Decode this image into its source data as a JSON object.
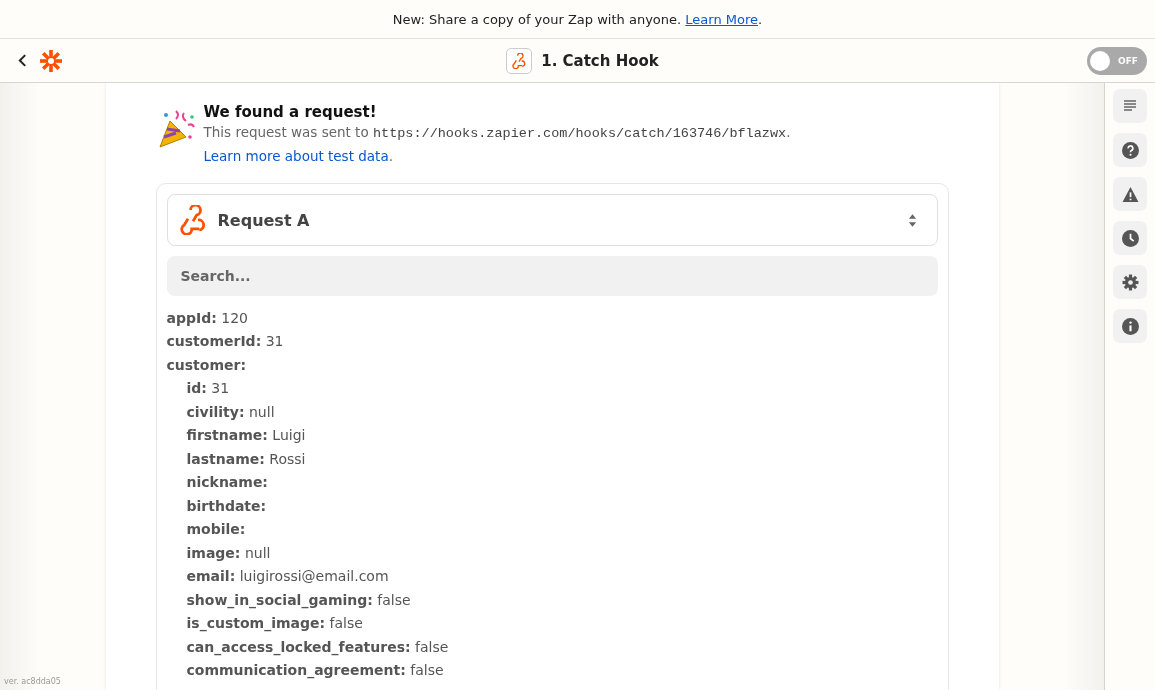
{
  "banner": {
    "text": "New: Share a copy of your Zap with anyone.",
    "link": "Learn More",
    "suffix": "."
  },
  "header": {
    "title": "1. Catch Hook",
    "toggle": {
      "label": "OFF",
      "on": false
    }
  },
  "found": {
    "title": "We found a request!",
    "prefix": "This request was sent to",
    "url": "https://hooks.zapier.com/hooks/catch/163746/bflazwx",
    "after": ".",
    "link": "Learn more about test data",
    "end": "."
  },
  "request_select": {
    "value": "Request A"
  },
  "search": {
    "placeholder": "Search..."
  },
  "fields": [
    {
      "key": "appId:",
      "value": "120"
    },
    {
      "key": "customerId:",
      "value": "31"
    },
    {
      "key": "customer:",
      "children": [
        {
          "key": "id:",
          "value": "31"
        },
        {
          "key": "civility:",
          "value": "null"
        },
        {
          "key": "firstname:",
          "value": "Luigi"
        },
        {
          "key": "lastname:",
          "value": "Rossi"
        },
        {
          "key": "nickname:"
        },
        {
          "key": "birthdate:"
        },
        {
          "key": "mobile:"
        },
        {
          "key": "image:",
          "value": "null"
        },
        {
          "key": "email:",
          "value": "luigirossi@email.com"
        },
        {
          "key": "show_in_social_gaming:",
          "value": "false"
        },
        {
          "key": "is_custom_image:",
          "value": "false"
        },
        {
          "key": "can_access_locked_features:",
          "value": "false"
        },
        {
          "key": "communication_agreement:",
          "value": "false"
        }
      ]
    }
  ],
  "sidebar": {
    "items": [
      {
        "kind": "details"
      },
      {
        "kind": "help"
      },
      {
        "kind": "warning"
      },
      {
        "kind": "history"
      },
      {
        "kind": "settings"
      },
      {
        "kind": "info"
      }
    ]
  },
  "version": "ver. ac8dda05"
}
